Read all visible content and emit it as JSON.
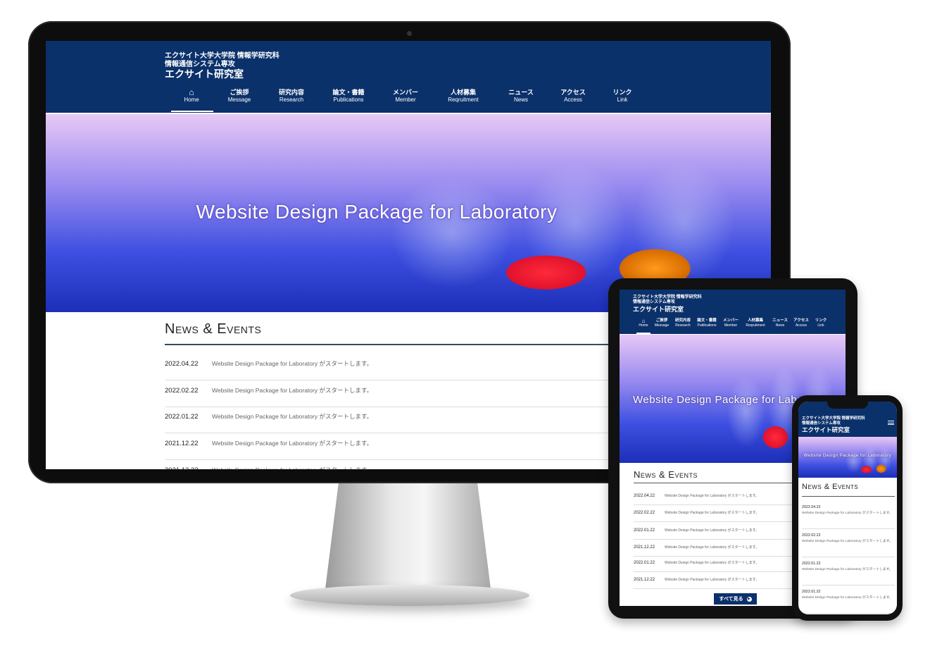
{
  "header": {
    "line1": "エクサイト大学大学院 情報学研究科",
    "line2": "情報通信システム専攻",
    "lab": "エクサイト研究室"
  },
  "nav": [
    {
      "ja": "⌂",
      "en": "Home",
      "icon": "home-icon"
    },
    {
      "ja": "ご挨拶",
      "en": "Message"
    },
    {
      "ja": "研究内容",
      "en": "Research"
    },
    {
      "ja": "論文・書籍",
      "en": "Publications"
    },
    {
      "ja": "メンバー",
      "en": "Member"
    },
    {
      "ja": "人材募集",
      "en": "Reqruitment"
    },
    {
      "ja": "ニュース",
      "en": "News"
    },
    {
      "ja": "アクセス",
      "en": "Access"
    },
    {
      "ja": "リンク",
      "en": "Link"
    }
  ],
  "hero": {
    "title": "Website Design Package for Laboratory"
  },
  "news": {
    "title": "News & Events",
    "more_label": "すべて見る",
    "desktop": [
      {
        "date": "2022.04.22",
        "text": "Website Design Package for Laboratory がスタートします。"
      },
      {
        "date": "2022.02.22",
        "text": "Website Design Package for Laboratory がスタートします。"
      },
      {
        "date": "2022.01.22",
        "text": "Website Design Package for Laboratory がスタートします。"
      },
      {
        "date": "2021.12.22",
        "text": "Website Design Package for Laboratory がスタートします。"
      },
      {
        "date": "2021.12.22",
        "text": "Website Design Package for Laboratory がスタートします。"
      }
    ],
    "tablet": [
      {
        "date": "2022.04.22",
        "text": "Website Design Package for Laboratory がスタートします。"
      },
      {
        "date": "2022.02.22",
        "text": "Website Design Package for Laboratory がスタートします。"
      },
      {
        "date": "2022.01.22",
        "text": "Website Design Package for Laboratory がスタートします。"
      },
      {
        "date": "2021.12.22",
        "text": "Website Design Package for Laboratory がスタートします。"
      },
      {
        "date": "2022.01.22",
        "text": "Website Design Package for Laboratory がスタートします。"
      },
      {
        "date": "2021.12.22",
        "text": "Website Design Package for Laboratory がスタートします。"
      }
    ],
    "phone": [
      {
        "date": "2022.04.22",
        "text": "Website Design Package for Laboratory がスタートします。"
      },
      {
        "date": "2022.02.22",
        "text": "Website Design Package for Laboratory がスタートします。"
      },
      {
        "date": "2022.01.22",
        "text": "Website Design Package for Laboratory がスタートします。"
      },
      {
        "date": "2022.01.22",
        "text": "Website Design Package for Laboratory がスタートします。"
      }
    ]
  },
  "colors": {
    "header": "#0b316b",
    "accent": "#0b316b"
  }
}
